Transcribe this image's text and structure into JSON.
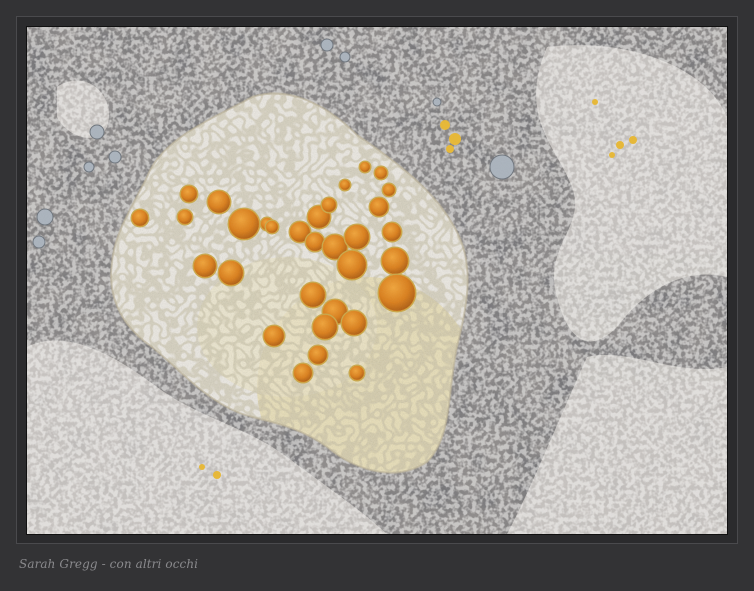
{
  "caption": "Sarah Gregg - con altri occhi",
  "photo": {
    "subject": "lichen-on-rock",
    "colors": {
      "rock_dark": "#3a3a3c",
      "rock_mid": "#8c8a8a",
      "crust_white": "#e9e6df",
      "crust_cream": "#e6dcb4",
      "apothecia_orange": "#e08a22",
      "apothecia_rim": "#c9a84a"
    }
  }
}
